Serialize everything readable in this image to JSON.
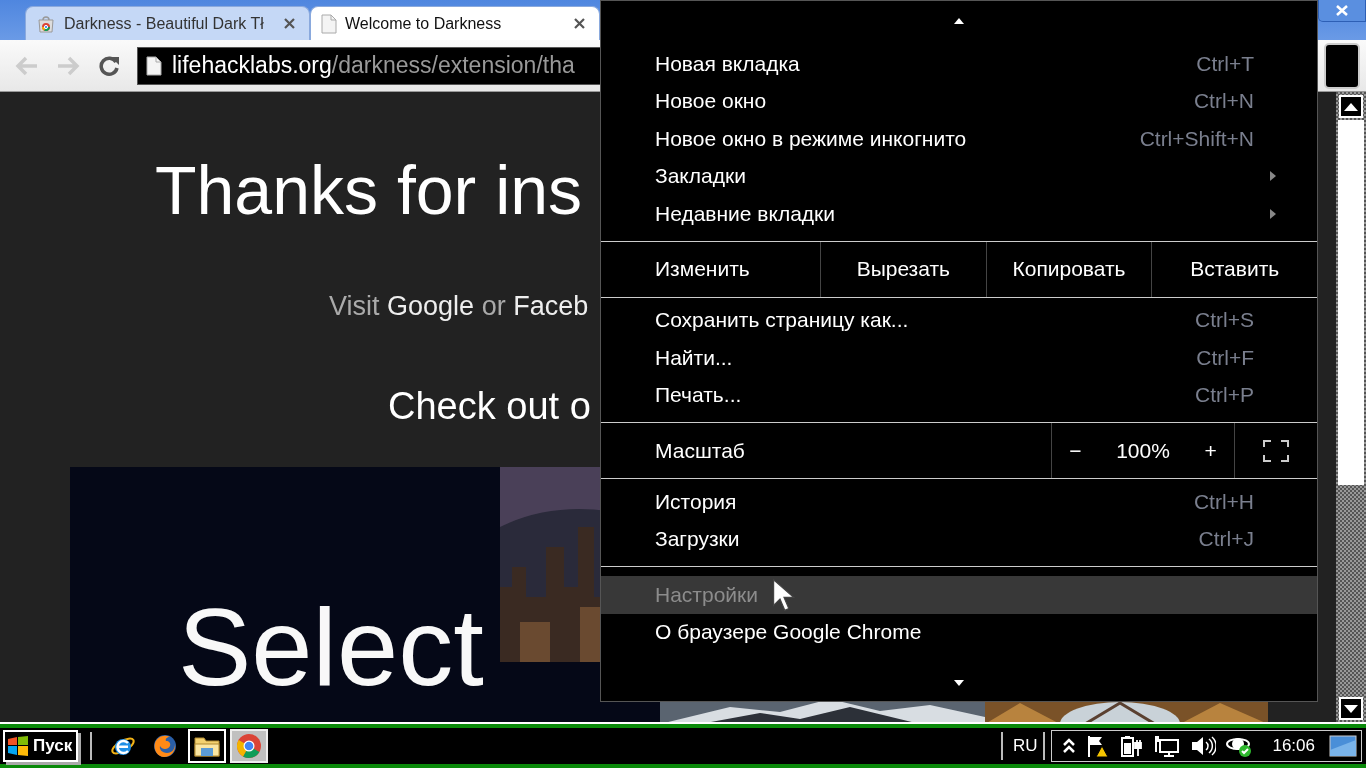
{
  "tabs": [
    {
      "kind": "store",
      "title": "Darkness - Beautiful Dark Tł",
      "selected": false
    },
    {
      "kind": "page",
      "title": "Welcome to Darkness",
      "selected": true
    }
  ],
  "toolbar": {
    "back_disabled": true,
    "forward_disabled": true,
    "url_host": "lifehacklabs.org",
    "url_path": "/darkness/extension/tha"
  },
  "page": {
    "heading": "Thanks for ins",
    "visit": [
      {
        "text": "Visit",
        "highlight": false
      },
      {
        "text": "Google",
        "highlight": true
      },
      {
        "text": "or",
        "highlight": false
      },
      {
        "text": "Faceb",
        "highlight": true
      }
    ],
    "subheading": "Check out o",
    "banner": {
      "title": "Select",
      "kind": "picture"
    }
  },
  "menu": {
    "sections": [
      {
        "items": [
          {
            "kind": "item",
            "label": "Новая вкладка",
            "shortcut": "Ctrl+T",
            "submenu": false,
            "selected": false
          },
          {
            "kind": "item",
            "label": "Новое окно",
            "shortcut": "Ctrl+N",
            "submenu": false,
            "selected": false
          },
          {
            "kind": "item",
            "label": "Новое окно в режиме инкогнито",
            "shortcut": "Ctrl+Shift+N",
            "submenu": false,
            "selected": false
          },
          {
            "kind": "item",
            "label": "Закладки",
            "submenu": true,
            "selected": false
          },
          {
            "kind": "item",
            "label": "Недавние вкладки",
            "submenu": true,
            "selected": false
          }
        ]
      },
      {
        "items": [
          {
            "kind": "edit",
            "label": "Изменить",
            "buttons": [
              "Вырезать",
              "Копировать",
              "Вставить"
            ]
          }
        ]
      },
      {
        "items": [
          {
            "kind": "item",
            "label": "Сохранить страницу как...",
            "shortcut": "Ctrl+S",
            "submenu": false,
            "selected": false
          },
          {
            "kind": "item",
            "label": "Найти...",
            "shortcut": "Ctrl+F",
            "submenu": false,
            "selected": false
          },
          {
            "kind": "item",
            "label": "Печать...",
            "shortcut": "Ctrl+P",
            "submenu": false,
            "selected": false
          }
        ]
      },
      {
        "items": [
          {
            "kind": "zoom",
            "label": "Масштаб",
            "minus": "−",
            "value": "100%",
            "plus": "+"
          }
        ]
      },
      {
        "items": [
          {
            "kind": "item",
            "label": "История",
            "shortcut": "Ctrl+H",
            "submenu": false,
            "selected": false
          },
          {
            "kind": "item",
            "label": "Загрузки",
            "shortcut": "Ctrl+J",
            "submenu": false,
            "selected": false
          }
        ]
      },
      {
        "items": [
          {
            "kind": "item",
            "label": "Настройки",
            "submenu": false,
            "selected": true
          },
          {
            "kind": "item",
            "label": "О браузере Google Chrome",
            "submenu": false,
            "selected": false
          }
        ]
      }
    ]
  },
  "taskbar": {
    "start": "Пуск",
    "apps": [
      {
        "kind": "ie",
        "pressed": false,
        "outlined": false
      },
      {
        "kind": "firefox",
        "pressed": false,
        "outlined": false
      },
      {
        "kind": "folder",
        "pressed": false,
        "outlined": true
      },
      {
        "kind": "chrome",
        "pressed": true,
        "outlined": false
      }
    ],
    "language": "RU",
    "clock": "16:06"
  }
}
